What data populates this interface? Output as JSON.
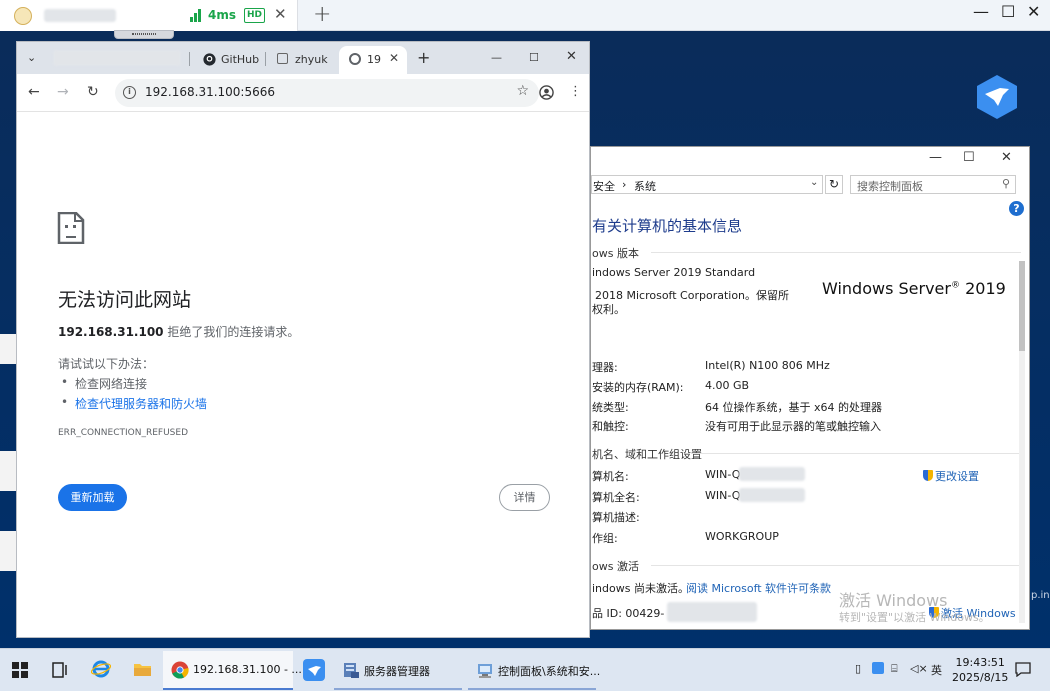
{
  "remote": {
    "latency": "4ms",
    "quality": "HD",
    "close_glyph": "✕",
    "new_tab": "+",
    "minimize": "—",
    "maximize": "☐",
    "close": "✕"
  },
  "browser": {
    "tabs": [
      {
        "label": "GitHub",
        "icon": "github-icon"
      },
      {
        "label": "zhyuk",
        "icon": "page-icon"
      },
      {
        "label": "19",
        "icon": "globe-icon",
        "active": true
      }
    ],
    "new_tab": "+",
    "win_min": "—",
    "win_max": "☐",
    "win_close": "✕",
    "url": "192.168.31.100:5666",
    "error": {
      "title": "无法访问此网站",
      "host": "192.168.31.100",
      "message": " 拒绝了我们的连接请求。",
      "try_label": "请试试以下办法：",
      "suggestion_1": "检查网络连接",
      "suggestion_2": "检查代理服务器和防火墙",
      "code": "ERR_CONNECTION_REFUSED",
      "reload": "重新加载",
      "details": "详情"
    }
  },
  "control_panel": {
    "breadcrumb_1": "安全",
    "breadcrumb_sep": "›",
    "breadcrumb_2": "系统",
    "search_placeholder": "搜索控制面板",
    "heading": "有关计算机的基本信息",
    "edition_section": "ows 版本",
    "edition_name": "indows Server 2019 Standard",
    "copyright_1": "2018 Microsoft Corporation。保留所",
    "copyright_2": "权利。",
    "logo_text": "Windows Server",
    "logo_version": "2019",
    "processor_label": "理器:",
    "processor_value": "Intel(R) N100   806 MHz",
    "ram_label": "安装的内存(RAM):",
    "ram_value": "4.00 GB",
    "systype_label": "统类型:",
    "systype_value": "64 位操作系统，基于 x64 的处理器",
    "pen_label": "和触控:",
    "pen_value": "没有可用于此显示器的笔或触控输入",
    "name_section": "机名、域和工作组设置",
    "comp_name_label": "算机名:",
    "comp_name_value": "WIN-Q",
    "full_name_label": "算机全名:",
    "full_name_value": "WIN-Q",
    "desc_label": "算机描述:",
    "workgroup_label": "作组:",
    "workgroup_value": "WORKGROUP",
    "change_settings": "更改设置",
    "activation_section": "ows 激活",
    "activation_status": "indows 尚未激活。",
    "license_link": "阅读 Microsoft 软件许可条款",
    "product_id_label": "品 ID: 00429-",
    "activate_link": "激活 Windows",
    "watermark_title": "激活 Windows",
    "watermark_sub": "转到\"设置\"以激活 Windows。",
    "side_text": "p.ini"
  },
  "taskbar": {
    "items": [
      {
        "label": "192.168.31.100 - ...",
        "icon": "chrome-icon"
      },
      {
        "label": "服务器管理器",
        "icon": "server-manager-icon"
      },
      {
        "label": "控制面板\\系统和安...",
        "icon": "control-panel-icon"
      }
    ],
    "ime": "英",
    "time": "19:43:51",
    "date": "2025/8/15"
  }
}
